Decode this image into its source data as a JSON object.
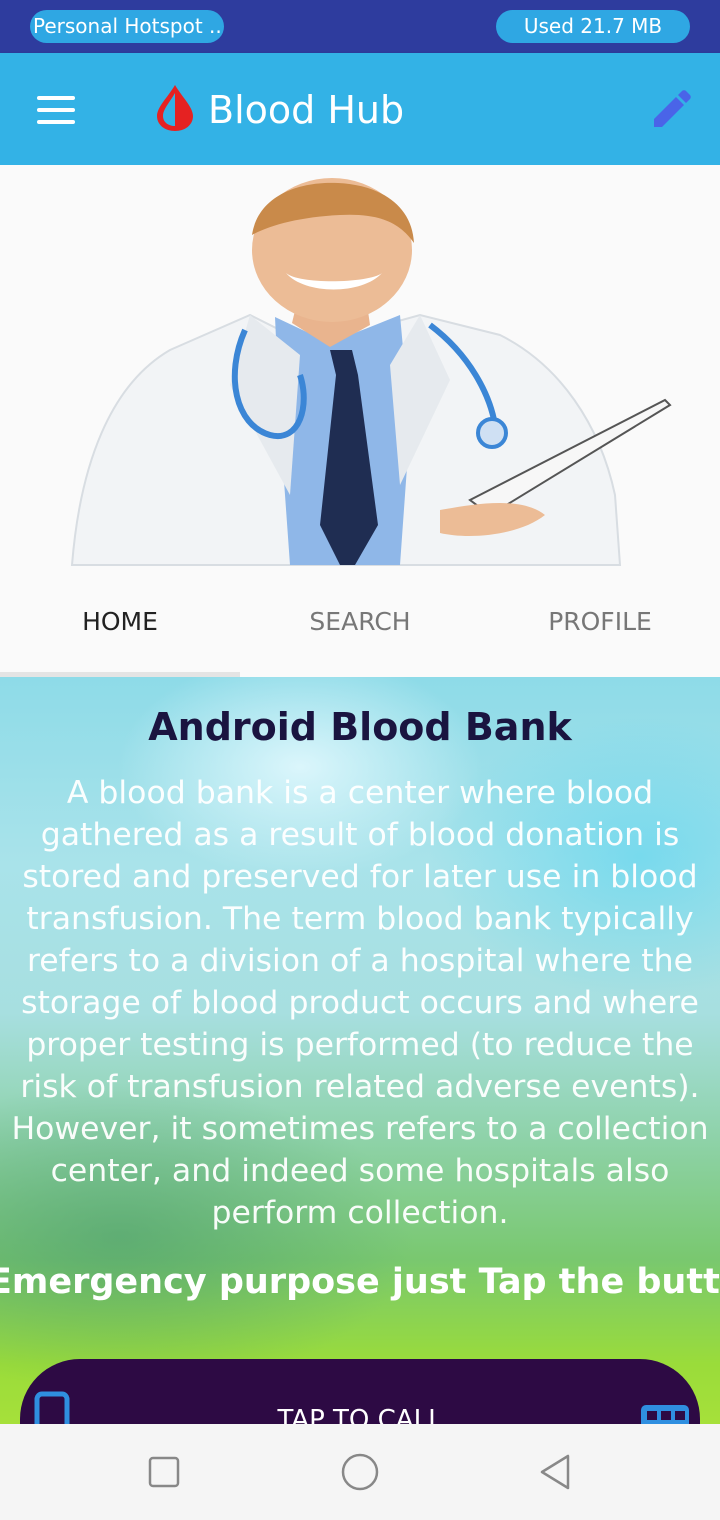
{
  "status_bar": {
    "hotspot_label": "Personal Hotspot ...",
    "data_usage": "Used  21.7 MB"
  },
  "app_bar": {
    "title": "Blood Hub",
    "menu_icon": "hamburger-menu-icon",
    "logo_icon": "blood-drop-icon",
    "edit_icon": "pencil-icon",
    "logo_color": "#e52222",
    "edit_color": "#4a64e8"
  },
  "hero": {
    "image": "doctor-photo"
  },
  "tabs": [
    {
      "label": "HOME",
      "active": true
    },
    {
      "label": "SEARCH",
      "active": false
    },
    {
      "label": "PROFILE",
      "active": false
    }
  ],
  "content": {
    "title": "Android Blood Bank",
    "description": "A blood bank is a center where blood gathered as a result of blood donation is stored and preserved for later use in blood transfusion. The term blood bank typically refers to a division of a hospital where the storage of blood product occurs and where proper testing is performed (to reduce the risk of transfusion related adverse events). However, it sometimes refers to a collection center, and indeed some hospitals also perform collection.",
    "marquee": "Emergency purpose just Tap the button"
  },
  "call_button": {
    "label": "TAP TO CALL",
    "left_icon": "phone-icon",
    "right_icon": "bus-icon",
    "color": "#2d0a44"
  },
  "nav_bar": {
    "recent_icon": "square-icon",
    "home_icon": "circle-icon",
    "back_icon": "triangle-back-icon"
  }
}
